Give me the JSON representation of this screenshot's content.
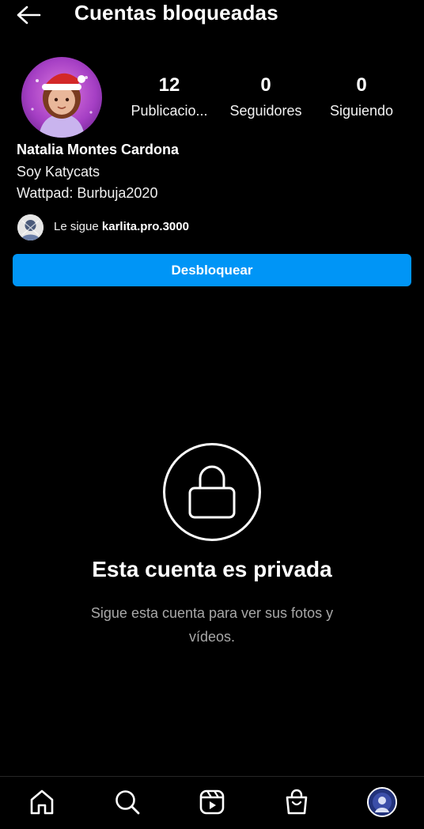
{
  "header": {
    "title": "Cuentas bloqueadas",
    "back_icon": "arrow-left-icon"
  },
  "profile": {
    "stats": [
      {
        "value": "12",
        "label": "Publicacio..."
      },
      {
        "value": "0",
        "label": "Seguidores"
      },
      {
        "value": "0",
        "label": "Siguiendo"
      }
    ],
    "name": "Natalia Montes Cardona",
    "bio": [
      "Soy Katycats",
      "Wattpad: Burbuja2020"
    ],
    "followed_by_prefix": "Le sigue",
    "followed_by_user": "karlita.pro.3000"
  },
  "actions": {
    "unblock_label": "Desbloquear",
    "accent_color": "#0095f6"
  },
  "private_notice": {
    "icon": "lock-icon",
    "title": "Esta cuenta es privada",
    "description": "Sigue esta cuenta para ver sus fotos y vídeos."
  },
  "bottom_nav": {
    "items": [
      "home-icon",
      "search-icon",
      "reels-icon",
      "shop-icon",
      "profile-avatar"
    ]
  }
}
